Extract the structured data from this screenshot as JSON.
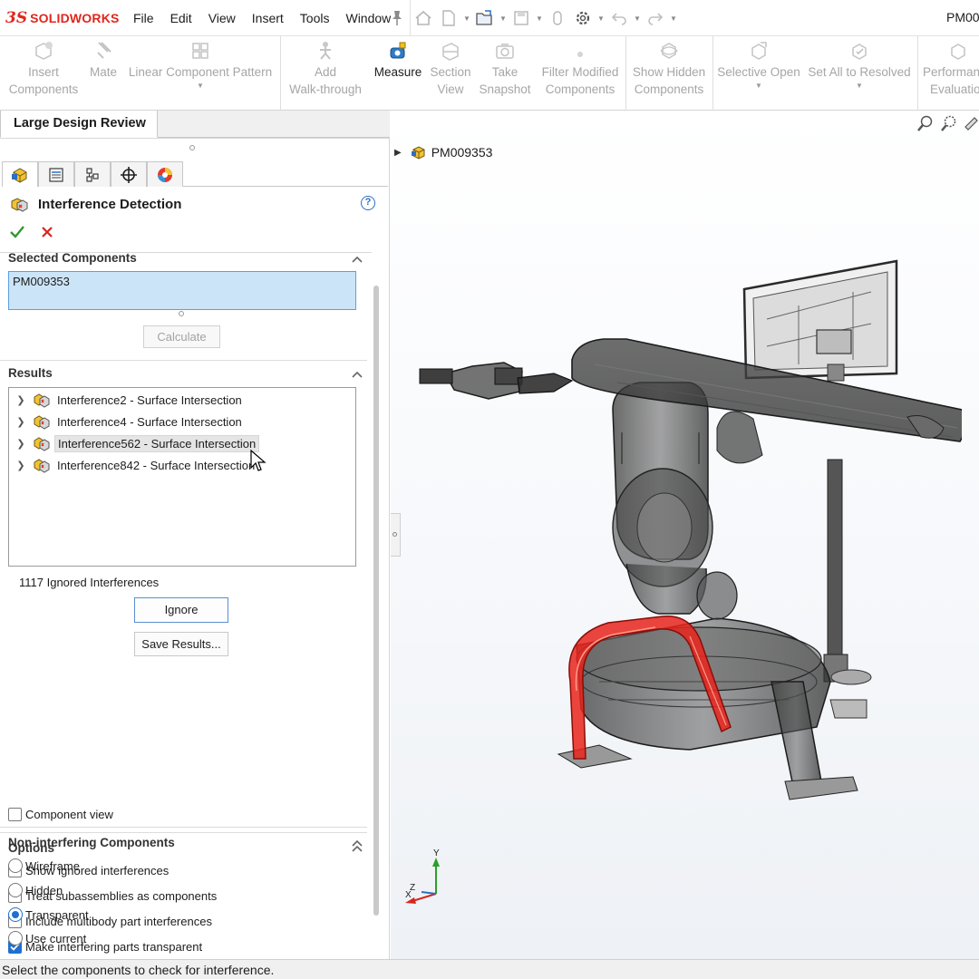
{
  "app": {
    "logo_mark": "3S",
    "logo_text": "SOLIDWORKS",
    "document_title": "PM00"
  },
  "menu": [
    "File",
    "Edit",
    "View",
    "Insert",
    "Tools",
    "Window"
  ],
  "quick_access_icons": [
    "home-icon",
    "new-document-icon",
    "open-folder-icon",
    "save-icon",
    "print-icon",
    "options-gear-icon",
    "undo-icon",
    "redo-icon"
  ],
  "commands": [
    {
      "label1": "Insert",
      "label2": "Components",
      "icon": "insert-components-icon",
      "enabled": false
    },
    {
      "label1": "Mate",
      "label2": "",
      "icon": "mate-icon",
      "enabled": false
    },
    {
      "label1": "Linear Component Pattern",
      "label2": "",
      "icon": "linear-pattern-icon",
      "enabled": false
    },
    {
      "label1": "Add",
      "label2": "Walk-through",
      "icon": "walk-through-icon",
      "enabled": false
    },
    {
      "label1": "Measure",
      "label2": "",
      "icon": "measure-icon",
      "enabled": true
    },
    {
      "label1": "Section",
      "label2": "View",
      "icon": "section-view-icon",
      "enabled": false
    },
    {
      "label1": "Take",
      "label2": "Snapshot",
      "icon": "snapshot-icon",
      "enabled": false
    },
    {
      "label1": "Filter Modified",
      "label2": "Components",
      "icon": "filter-modified-icon",
      "enabled": false
    },
    {
      "label1": "Show Hidden",
      "label2": "Components",
      "icon": "show-hidden-icon",
      "enabled": false
    },
    {
      "label1": "Selective Open",
      "label2": "",
      "icon": "selective-open-icon",
      "enabled": false
    },
    {
      "label1": "Set All to Resolved",
      "label2": "",
      "icon": "set-resolved-icon",
      "enabled": false
    },
    {
      "label1": "Performan",
      "label2": "Evaluatio",
      "icon": "performance-icon",
      "enabled": false
    }
  ],
  "left_tab": "Large Design Review",
  "property_manager": {
    "title": "Interference Detection",
    "help": "?",
    "selected_components": {
      "title": "Selected Components",
      "value": "PM009353",
      "calculate_label": "Calculate"
    },
    "results": {
      "title": "Results",
      "items": [
        {
          "label": "Interference2 - Surface Intersection",
          "highlighted": false
        },
        {
          "label": "Interference4 - Surface Intersection",
          "highlighted": false
        },
        {
          "label": "Interference562 - Surface Intersection",
          "highlighted": true
        },
        {
          "label": "Interference842 - Surface Intersection",
          "highlighted": false
        }
      ],
      "ignored_count_text": "1117 Ignored Interferences",
      "ignore_label": "Ignore",
      "save_results_label": "Save Results...",
      "component_view_label": "Component view",
      "component_view_checked": false
    },
    "options": {
      "title": "Options",
      "items": [
        {
          "label": "Show ignored interferences",
          "checked": false
        },
        {
          "label": "Treat subassemblies as components",
          "checked": false
        },
        {
          "label": "Include multibody part interferences",
          "checked": false
        },
        {
          "label": "Make interfering parts transparent",
          "checked": true
        }
      ]
    },
    "non_interfering": {
      "title": "Non-interfering Components",
      "items": [
        {
          "label": "Wireframe",
          "selected": false
        },
        {
          "label": "Hidden",
          "selected": false
        },
        {
          "label": "Transparent",
          "selected": true
        },
        {
          "label": "Use current",
          "selected": false
        }
      ]
    }
  },
  "viewport": {
    "tree_root": "PM009353",
    "triad": {
      "x": "X",
      "y": "Y",
      "z": "Z"
    },
    "highlight_color": "#e8251c"
  },
  "status_text": "Select the components to check for interference."
}
